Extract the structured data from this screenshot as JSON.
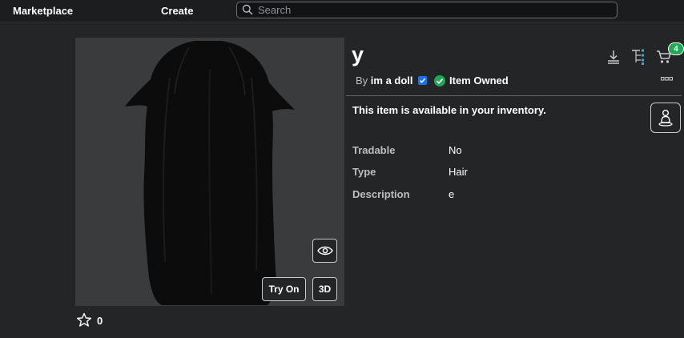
{
  "nav": {
    "marketplace": "Marketplace",
    "create": "Create",
    "search_placeholder": "Search"
  },
  "item": {
    "name": "y",
    "by_label": "By",
    "creator": "im a doll",
    "owned_label": "Item Owned",
    "availability": "This item is available in your inventory.",
    "favorites": "0"
  },
  "thumbnail": {
    "try_on": "Try On",
    "view_3d": "3D"
  },
  "details": [
    {
      "label": "Tradable",
      "value": "No"
    },
    {
      "label": "Type",
      "value": "Hair"
    },
    {
      "label": "Description",
      "value": "e"
    }
  ],
  "cart": {
    "count": "4"
  },
  "colors": {
    "background": "#232527",
    "topbar": "#1b1d1f",
    "owned_green": "#1fa855",
    "verified_blue": "#1a73e8",
    "thumbnail_bg": "#393b3d"
  },
  "icons": {
    "download": "download-icon",
    "tree": "hierarchy-icon",
    "cart": "shopping-cart-icon",
    "more": "more-options-icon",
    "eye": "eye-icon",
    "star": "star-icon",
    "avatar": "avatar-icon",
    "search": "search-icon"
  }
}
